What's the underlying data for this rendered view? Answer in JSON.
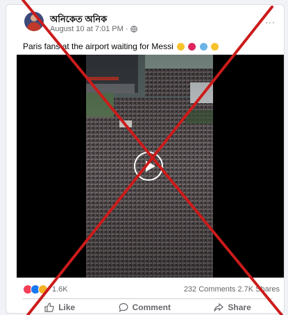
{
  "post": {
    "author": "অনিকেত অনিক",
    "timestamp": "August 10 at 7:01 PM ·",
    "caption": "Paris fans at the airport waiting for Messi",
    "more_label": "···"
  },
  "stats": {
    "reactions": "1.6K",
    "comments_shares": "232 Comments  2.7K Shares"
  },
  "actions": {
    "like": "Like",
    "comment": "Comment",
    "share": "Share"
  },
  "colors": {
    "cross": "#cc1b1b",
    "like_blue": "#1877f2",
    "love_red": "#f33e58",
    "wow_yellow": "#f7b125"
  }
}
